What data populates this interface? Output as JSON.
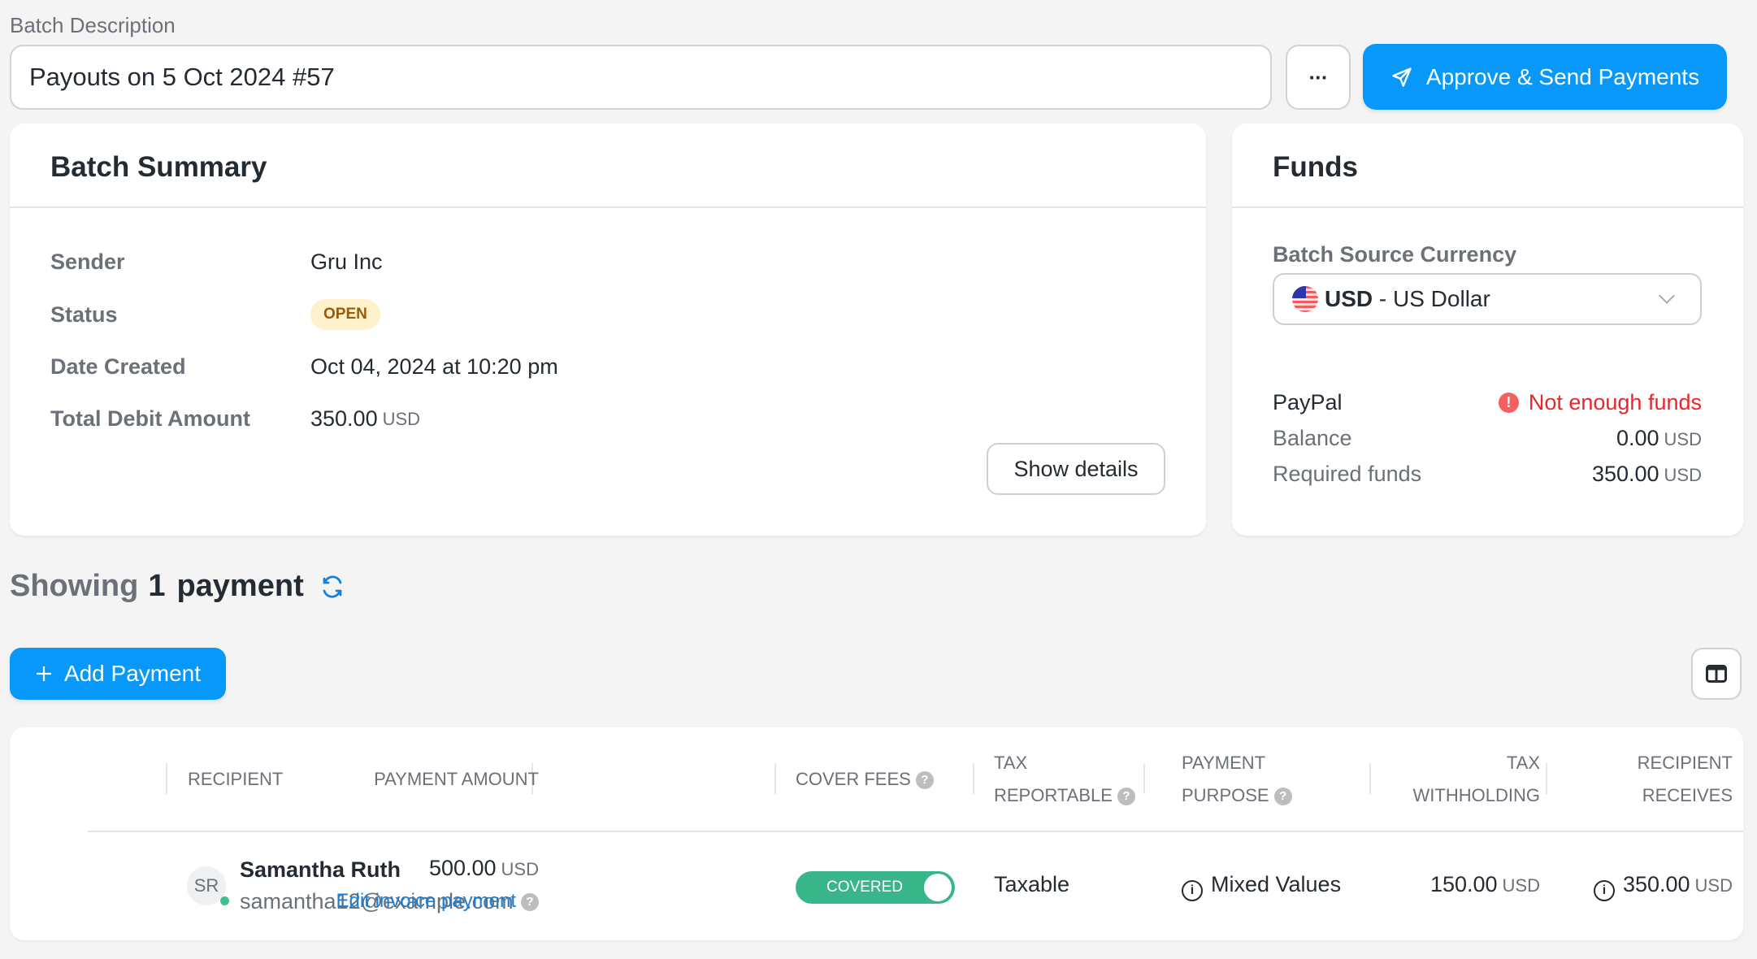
{
  "header": {
    "description_label": "Batch Description",
    "description_value": "Payouts on 5 Oct 2024 #57",
    "more_label": "···",
    "approve_label": "Approve & Send Payments"
  },
  "summary": {
    "title": "Batch Summary",
    "rows": [
      {
        "label": "Sender",
        "value": "Gru Inc"
      },
      {
        "label": "Status",
        "value": "OPEN"
      },
      {
        "label": "Date Created",
        "value": "Oct 04, 2024 at 10:20 pm"
      },
      {
        "label": "Total Debit Amount",
        "value": "350.00",
        "unit": "USD"
      }
    ],
    "show_details_label": "Show details"
  },
  "funds": {
    "title": "Funds",
    "currency_label": "Batch Source Currency",
    "currency_code": "USD",
    "currency_name": " - US Dollar",
    "provider": "PayPal",
    "warning": "Not enough funds",
    "balance_label": "Balance",
    "balance_value": "0.00",
    "required_label": "Required funds",
    "required_value": "350.00",
    "unit": "USD",
    "colors": {
      "warning": "#e8262b"
    }
  },
  "payments": {
    "showing_prefix": "Showing",
    "count": "1",
    "noun": "payment",
    "add_label": "Add Payment",
    "columns": {
      "recipient": "RECIPIENT",
      "payment_amount": "PAYMENT AMOUNT",
      "cover_fees": "COVER FEES",
      "tax_reportable_1": "TAX",
      "tax_reportable_2": "REPORTABLE",
      "payment_purpose_1": "PAYMENT",
      "payment_purpose_2": "PURPOSE",
      "tax_withholding_1": "TAX",
      "tax_withholding_2": "WITHHOLDING",
      "recipient_receives_1": "RECIPIENT",
      "recipient_receives_2": "RECEIVES"
    },
    "rows": [
      {
        "initials": "SR",
        "name": "Samantha Ruth",
        "email": "samantha12@example.com",
        "amount": "500.00",
        "unit": "USD",
        "edit_label": "Edit invoice payment",
        "cover_fees": "COVERED",
        "tax_reportable": "Taxable",
        "payment_purpose": "Mixed Values",
        "tax_withholding": "150.00",
        "receives": "350.00"
      }
    ]
  },
  "colors": {
    "primary": "#0898fa",
    "covered": "#38b68a",
    "badge_open_bg": "#fff1cc",
    "badge_open_text": "#9a5a07"
  }
}
